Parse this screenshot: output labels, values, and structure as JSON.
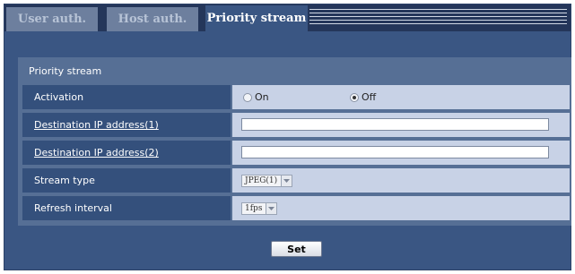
{
  "tabs": [
    {
      "label": "User auth.",
      "active": false
    },
    {
      "label": "Host auth.",
      "active": false
    },
    {
      "label": "Priority stream",
      "active": true
    }
  ],
  "panel": {
    "title": "Priority stream",
    "activation": {
      "label": "Activation",
      "options": [
        "On",
        "Off"
      ],
      "selected": "Off"
    },
    "dest1": {
      "label": "Destination IP address(1)",
      "value": ""
    },
    "dest2": {
      "label": "Destination IP address(2)",
      "value": ""
    },
    "stream_type": {
      "label": "Stream type",
      "selected": "JPEG(1)"
    },
    "refresh": {
      "label": "Refresh interval",
      "selected": "1fps"
    }
  },
  "set_label": "Set",
  "colors": {
    "background": "#3a5683",
    "tabbar": "#24365a",
    "label_cell": "#34507c",
    "value_cell": "#c8d2e6"
  }
}
